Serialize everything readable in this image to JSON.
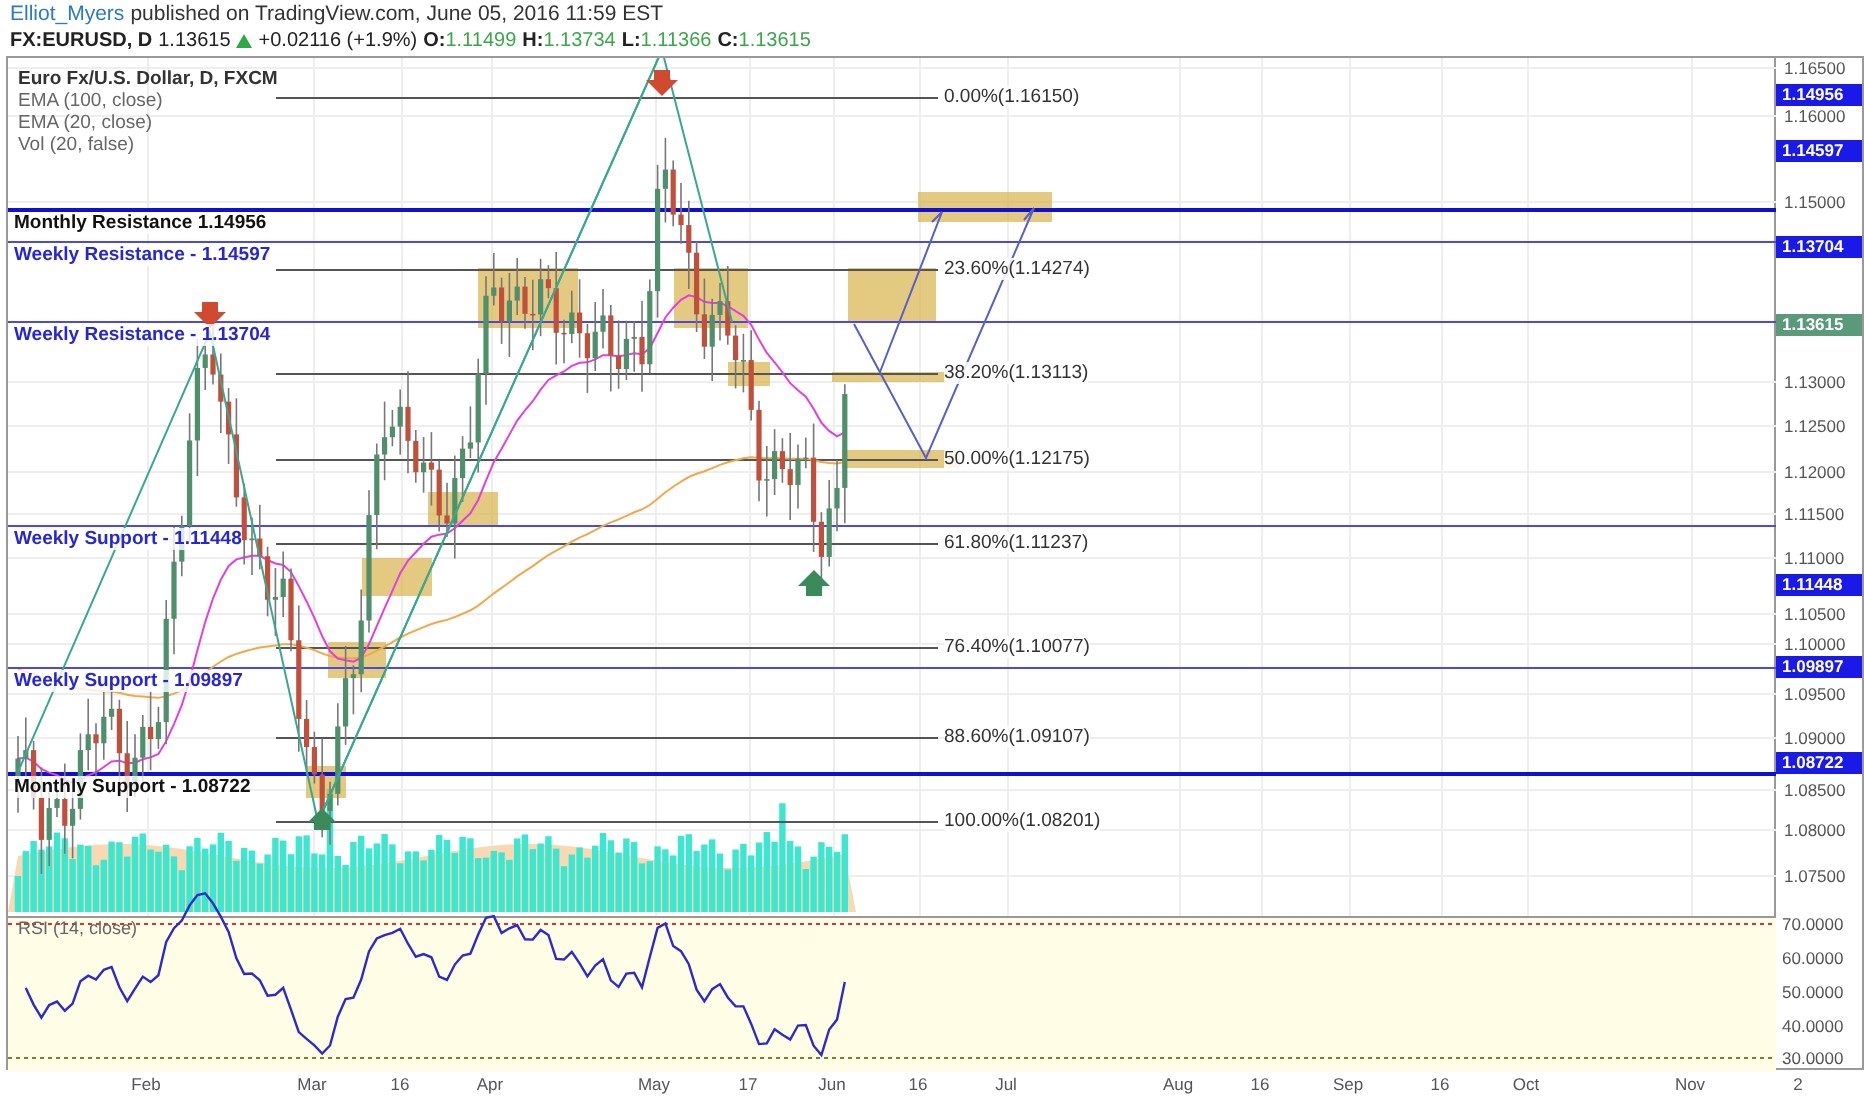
{
  "header": {
    "author": "Elliot_Myers",
    "published": "published on TradingView.com, June 05, 2016 11:59 EST"
  },
  "quote": {
    "symbol": "FX:EURUSD, D",
    "price": "1.13615",
    "change": "+0.02116 (+1.9%)",
    "ohlc": [
      {
        "label": "O:",
        "value": "1.11499"
      },
      {
        "label": "H:",
        "value": "1.13734"
      },
      {
        "label": "L:",
        "value": "1.11366"
      },
      {
        "label": "C:",
        "value": "1.13615"
      }
    ]
  },
  "legend": {
    "title": "Euro Fx/U.S. Dollar, D, FXCM",
    "studies": [
      "EMA (100, close)",
      "EMA (20, close)",
      "Vol (20, false)"
    ]
  },
  "levels": [
    {
      "label": "Monthly Resistance 1.14956",
      "kind": "monthly"
    },
    {
      "label": "Weekly Resistance - 1.14597",
      "kind": "weekly"
    },
    {
      "label": "Weekly Resistance - 1.13704",
      "kind": "weekly"
    },
    {
      "label": "Weekly Support - 1.11448",
      "kind": "weekly"
    },
    {
      "label": "Weekly Support - 1.09897",
      "kind": "weekly"
    },
    {
      "label": "Monthly Support - 1.08722",
      "kind": "monthly"
    }
  ],
  "fibonacci": [
    "0.00%(1.16150)",
    "23.60%(1.14274)",
    "38.20%(1.13113)",
    "50.00%(1.12175)",
    "61.80%(1.11237)",
    "76.40%(1.10077)",
    "88.60%(1.09107)",
    "100.00%(1.08201)"
  ],
  "price_axis": {
    "ticks": [
      "1.16500",
      "1.16000",
      "1.15000",
      "1.13000",
      "1.12500",
      "1.12000",
      "1.11500",
      "1.11000",
      "1.10500",
      "1.10000",
      "1.09500",
      "1.09000",
      "1.08500",
      "1.08000",
      "1.07500"
    ],
    "tags": [
      {
        "value": "1.14956",
        "kind": "level"
      },
      {
        "value": "1.14597",
        "kind": "level"
      },
      {
        "value": "1.13704",
        "kind": "level"
      },
      {
        "value": "1.13615",
        "kind": "last"
      },
      {
        "value": "1.11448",
        "kind": "level"
      },
      {
        "value": "1.09897",
        "kind": "level"
      },
      {
        "value": "1.08722",
        "kind": "level"
      }
    ]
  },
  "rsi": {
    "legend": "RSI (14, close)",
    "ticks": [
      "70.0000",
      "60.0000",
      "50.0000",
      "40.0000",
      "30.0000"
    ]
  },
  "time_axis": [
    "Feb",
    "Mar",
    "16",
    "Apr",
    "May",
    "17",
    "Jun",
    "16",
    "Jul",
    "Aug",
    "16",
    "Sep",
    "16",
    "Oct",
    "Nov",
    "2"
  ]
}
